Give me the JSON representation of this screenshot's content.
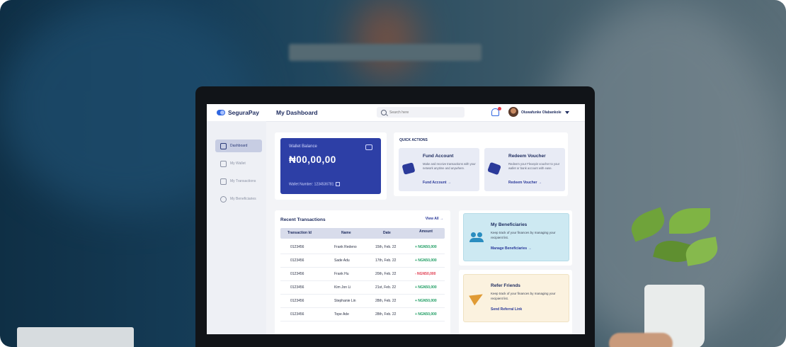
{
  "app": {
    "name": "SeguraPay",
    "page_title": "My Dashboard"
  },
  "search": {
    "placeholder": "Search here"
  },
  "user": {
    "name": "Oluwafunke Olabankole"
  },
  "sidebar": {
    "items": [
      {
        "label": "Dashboard",
        "icon": "grid-icon",
        "active": true
      },
      {
        "label": "My Wallet",
        "icon": "wallet-icon",
        "active": false
      },
      {
        "label": "My Transactions",
        "icon": "card-icon",
        "active": false
      },
      {
        "label": "My Beneficiaries",
        "icon": "user-icon",
        "active": false
      }
    ]
  },
  "wallet": {
    "label": "Wallet Balance",
    "amount": "₦00,00,00",
    "account_label": "Wallet Number: 1234536781"
  },
  "quick_actions": {
    "title": "QUICK ACTIONS",
    "fund": {
      "title": "Fund Account",
      "desc": "Make and receive transactions with your network anytime and anywhere.",
      "link": "Fund Account →"
    },
    "redeem": {
      "title": "Redeem Voucher",
      "desc": "Redeem your Flexepin voucher to your wallet or bank account with ease.",
      "link": "Redeem Voucher →"
    }
  },
  "transactions": {
    "title": "Recent Transactions",
    "view_all": "View All →",
    "columns": [
      "Transaction Id",
      "Name",
      "Date",
      "Amount"
    ],
    "rows": [
      {
        "id": "0123456",
        "name": "Frank Redeno",
        "date": "15th, Feb. 22",
        "amount": "+ NGN50,000",
        "type": "credit"
      },
      {
        "id": "0123456",
        "name": "Sade Adu",
        "date": "17th, Feb. 22",
        "amount": "+ NGN50,000",
        "type": "credit"
      },
      {
        "id": "0123456",
        "name": "Frank Hu",
        "date": "20th, Feb. 22",
        "amount": "- NGN50,000",
        "type": "debit"
      },
      {
        "id": "0123456",
        "name": "Kim Jon Li",
        "date": "21st, Feb. 22",
        "amount": "+ NGN50,000",
        "type": "credit"
      },
      {
        "id": "0123456",
        "name": "Stephanie Lin",
        "date": "28th, Feb. 22",
        "amount": "+ NGN50,000",
        "type": "credit"
      },
      {
        "id": "0123456",
        "name": "Tope Ade",
        "date": "28th, Feb. 22",
        "amount": "+ NGN50,000",
        "type": "credit"
      }
    ]
  },
  "beneficiaries": {
    "title": "My Beneficiaries",
    "desc": "Keep track of your finances by managing your recipient list.",
    "link": "Manage Beneficiaries →"
  },
  "refer": {
    "title": "Refer Friends",
    "desc": "Keep track of your finances by managing your recipient list.",
    "link": "Send Referral Link"
  },
  "colors": {
    "primary": "#2d3fa6",
    "credit": "#1f9d63",
    "debit": "#e03b4f"
  }
}
